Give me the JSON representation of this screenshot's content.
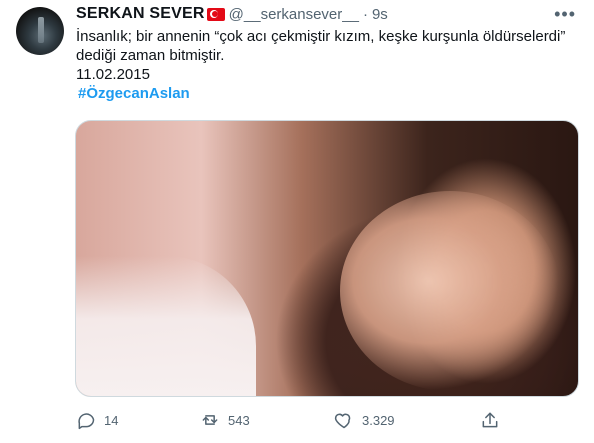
{
  "tweet": {
    "author_name": "SERKAN SEVER",
    "handle": "@__serkansever__",
    "separator": "·",
    "time": "9s",
    "text_lines": [
      "İnsanlık; bir annenin “çok acı çekmiştir kızım, keşke kurşunla öldürselerdi”",
      "dediği zaman bitmiştir.",
      "11.02.2015"
    ],
    "hashtag": "#ÖzgecanAslan",
    "more_icon": "more-horizontal-icon",
    "media_alt": "Close-up photo of a young woman with long dark hair, smiling"
  },
  "actions": {
    "replies": "14",
    "retweets": "543",
    "likes": "3.329"
  },
  "colors": {
    "text": "#0f1419",
    "secondary": "#536471",
    "link": "#1d9bf0",
    "border": "#cfd9de"
  },
  "icons": [
    "reply-icon",
    "retweet-icon",
    "like-icon",
    "share-icon"
  ]
}
